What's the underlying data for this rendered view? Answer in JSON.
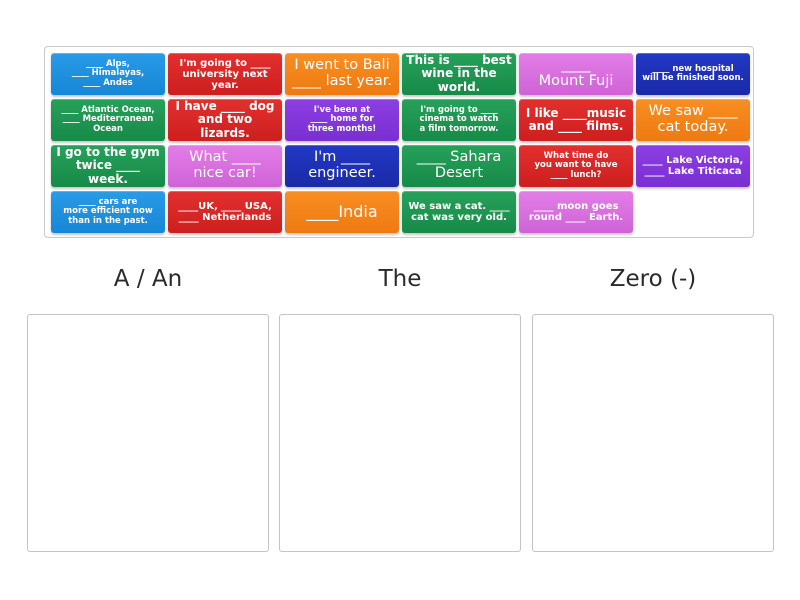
{
  "cards": [
    {
      "text": "____ Alps,\n____ Himalayas,\n____ Andes",
      "color": "blue",
      "size": "xs"
    },
    {
      "text": "I'm going to ____\nuniversity next year.",
      "color": "red",
      "size": "sm"
    },
    {
      "text": "I went to Bali\n____ last year.",
      "color": "orange",
      "size": "lg"
    },
    {
      "text": "This is ____ best\nwine in the world.",
      "color": "green",
      "size": "md"
    },
    {
      "text": "____\nMount Fuji",
      "color": "pink",
      "size": "lg"
    },
    {
      "text": "____ new hospital\nwill be finished soon.",
      "color": "navy",
      "size": "xs"
    },
    {
      "text": "____ Atlantic Ocean,\n____ Mediterranean\nOcean",
      "color": "green",
      "size": "xs"
    },
    {
      "text": "I have ____ dog\nand two lizards.",
      "color": "red",
      "size": "md"
    },
    {
      "text": "I've been at\n____ home for\nthree months!",
      "color": "purple",
      "size": "xs"
    },
    {
      "text": "I'm going to ____\ncinema to watch\na film tomorrow.",
      "color": "green",
      "size": "xs"
    },
    {
      "text": "I like ____music\nand ____ films.",
      "color": "red",
      "size": "md"
    },
    {
      "text": "We saw ____\ncat today.",
      "color": "orange",
      "size": "lg"
    },
    {
      "text": "I go to the gym\ntwice ____ week.",
      "color": "green",
      "size": "md"
    },
    {
      "text": "What ____\nnice car!",
      "color": "pink",
      "size": "lg"
    },
    {
      "text": "I'm ____\nengineer.",
      "color": "navy",
      "size": "lg"
    },
    {
      "text": "____ Sahara\nDesert",
      "color": "green",
      "size": "lg"
    },
    {
      "text": "What time do\nyou want to have\n____ lunch?",
      "color": "red",
      "size": "xs"
    },
    {
      "text": "____ Lake Victoria,\n____ Lake Titicaca",
      "color": "purple",
      "size": "sm"
    },
    {
      "text": "____ cars are\nmore efficient now\nthan in the past.",
      "color": "blue",
      "size": "xs"
    },
    {
      "text": "____UK, ____ USA,\n____ Netherlands",
      "color": "red",
      "size": "sm"
    },
    {
      "text": "____India",
      "color": "orange",
      "size": "xl"
    },
    {
      "text": "We saw a cat. ____\ncat was very old.",
      "color": "green",
      "size": "sm"
    },
    {
      "text": "____ moon goes\nround ____ Earth.",
      "color": "pink",
      "size": "sm"
    }
  ],
  "columns": [
    {
      "label": "A / An"
    },
    {
      "label": "The"
    },
    {
      "label": "Zero (-)"
    }
  ]
}
